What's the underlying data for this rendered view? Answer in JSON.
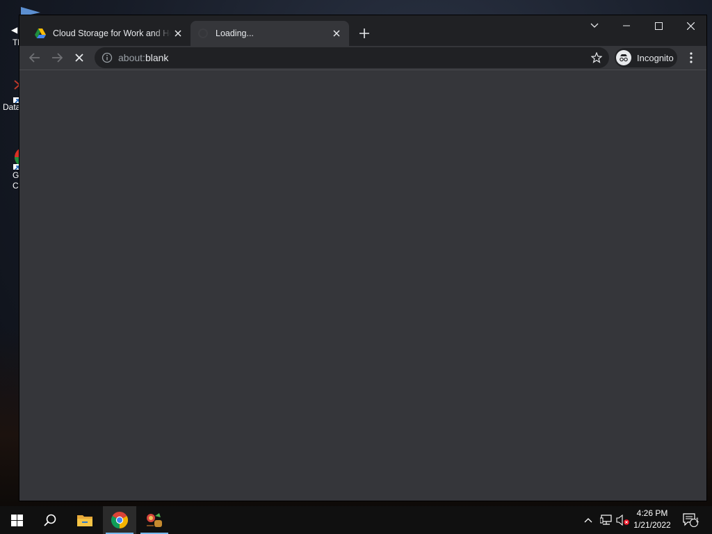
{
  "desktop": {
    "icons": [
      {
        "label": "Tl",
        "icon": "shortcut-icon"
      },
      {
        "label": "Data",
        "icon": "database-shortcut-icon"
      },
      {
        "label": "G Cl",
        "icon": "google-chrome-shortcut-icon"
      }
    ]
  },
  "browser": {
    "tabs": [
      {
        "title": "Cloud Storage for Work and Home",
        "favicon": "google-drive-icon",
        "active": false
      },
      {
        "title": "Loading...",
        "favicon": "loading-spinner-icon",
        "active": true
      }
    ],
    "new_tab_icon": "plus-icon",
    "window_controls": [
      "tab-search-icon",
      "minimize-icon",
      "maximize-icon",
      "close-icon"
    ],
    "toolbar": {
      "back_icon": "arrow-left-icon",
      "forward_icon": "arrow-right-icon",
      "stop_icon": "stop-x-icon"
    },
    "omnibox": {
      "scheme": "about:",
      "host": "blank"
    },
    "profile_label": "Incognito",
    "menu_icon": "kebab-menu-icon"
  },
  "taskbar": {
    "items": [
      "windows-start-icon",
      "search-icon",
      "file-explorer-icon",
      "chrome-icon",
      "app-icon"
    ],
    "tray": [
      "chevron-up-icon",
      "network-icon",
      "volume-muted-icon"
    ],
    "time": "4:26 PM",
    "date": "1/21/2022",
    "notification_count": "1"
  },
  "colors": {
    "tab_strip": "#202124",
    "toolbar": "#35363a",
    "taskbar": "#101010",
    "accent": "#76b9ed"
  }
}
